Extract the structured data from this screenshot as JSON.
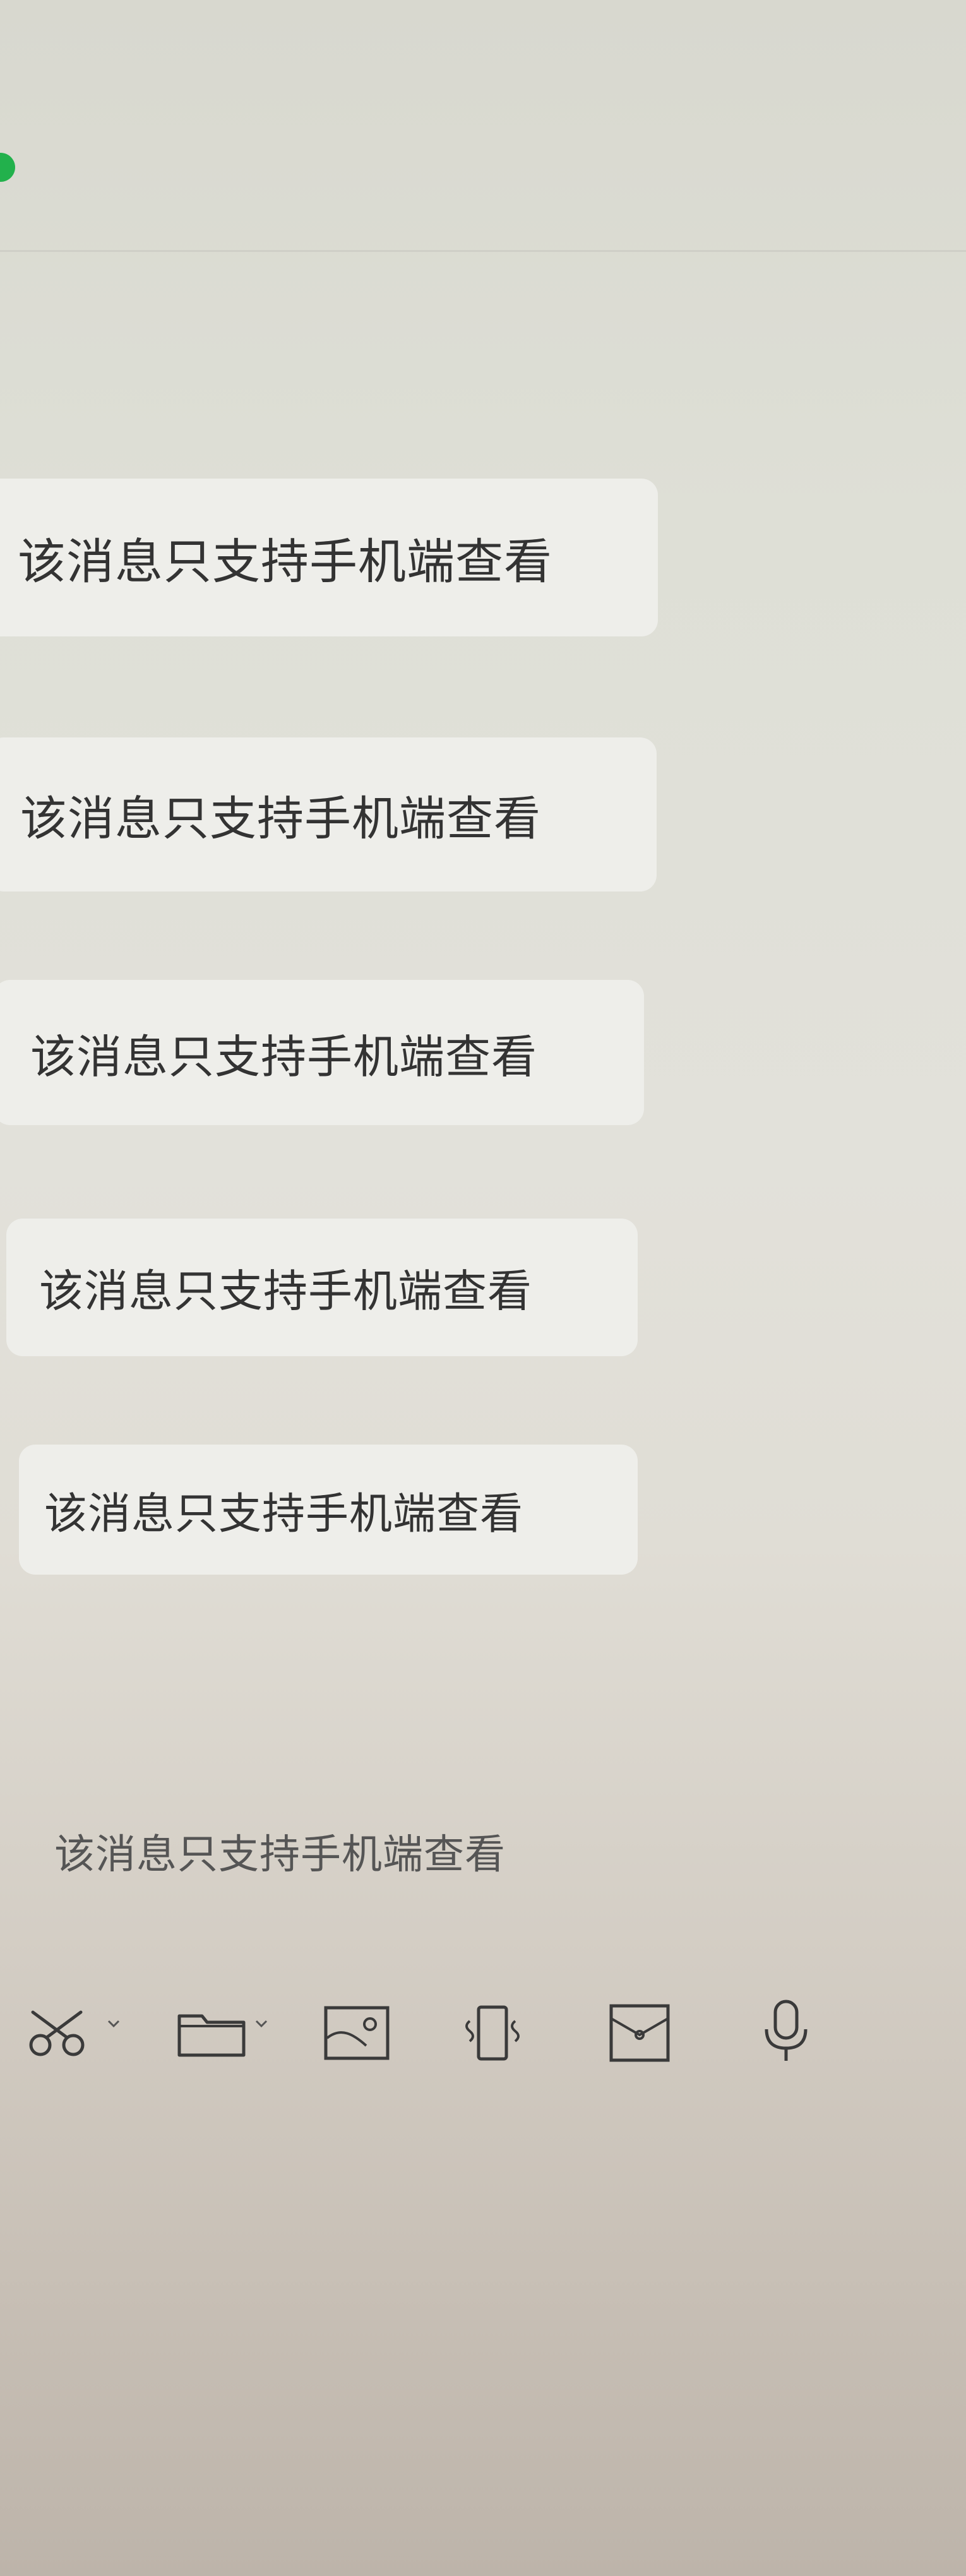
{
  "messages": [
    {
      "text": "该消息只支持手机端查看"
    },
    {
      "text": "该消息只支持手机端查看"
    },
    {
      "text": "该消息只支持手机端查看"
    },
    {
      "text": "该消息只支持手机端查看"
    },
    {
      "text": "该消息只支持手机端查看"
    },
    {
      "text": "该消息只支持手机端查看"
    }
  ],
  "toolbar": {
    "icons": [
      "scissors-icon",
      "folder-icon",
      "screenshot-icon",
      "phone-icon",
      "envelope-icon",
      "microphone-icon"
    ]
  },
  "colors": {
    "status_dot": "#22b14c",
    "bubble": "#eeeeea",
    "icon": "#3a3a3a"
  }
}
